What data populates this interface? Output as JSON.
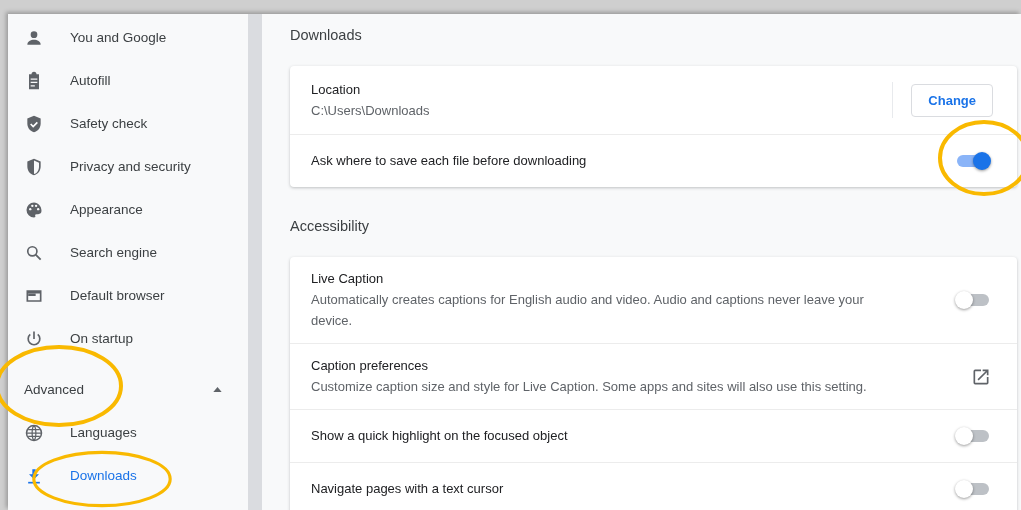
{
  "sidebar": {
    "items": [
      {
        "label": "You and Google",
        "kind": "person",
        "selected": false
      },
      {
        "label": "Autofill",
        "kind": "clipboard",
        "selected": false
      },
      {
        "label": "Safety check",
        "kind": "safety",
        "selected": false
      },
      {
        "label": "Privacy and security",
        "kind": "privacy",
        "selected": false
      },
      {
        "label": "Appearance",
        "kind": "appearance",
        "selected": false
      },
      {
        "label": "Search engine",
        "kind": "search",
        "selected": false
      },
      {
        "label": "Default browser",
        "kind": "browser",
        "selected": false
      },
      {
        "label": "On startup",
        "kind": "startup",
        "selected": false
      }
    ],
    "advanced": {
      "label": "Advanced",
      "expanded": true
    },
    "advanced_items": [
      {
        "label": "Languages",
        "kind": "languages",
        "selected": false
      },
      {
        "label": "Downloads",
        "kind": "downloads",
        "selected": true
      }
    ]
  },
  "sections": [
    {
      "title": "Downloads",
      "rows": [
        {
          "kind": "location",
          "title": "Location",
          "value": "C:\\Users\\Downloads",
          "button": "Change"
        },
        {
          "kind": "toggle",
          "title": "Ask where to save each file before downloading",
          "on": true
        }
      ]
    },
    {
      "title": "Accessibility",
      "rows": [
        {
          "kind": "toggle",
          "title": "Live Caption",
          "description": "Automatically creates captions for English audio and video. Audio and captions never leave your device.",
          "on": false
        },
        {
          "kind": "link",
          "title": "Caption preferences",
          "description": "Customize caption size and style for Live Caption. Some apps and sites will also use this setting."
        },
        {
          "kind": "toggle",
          "title": "Show a quick highlight on the focused object",
          "on": false
        },
        {
          "kind": "toggle",
          "title": "Navigate pages with a text cursor",
          "on": false
        }
      ]
    }
  ]
}
